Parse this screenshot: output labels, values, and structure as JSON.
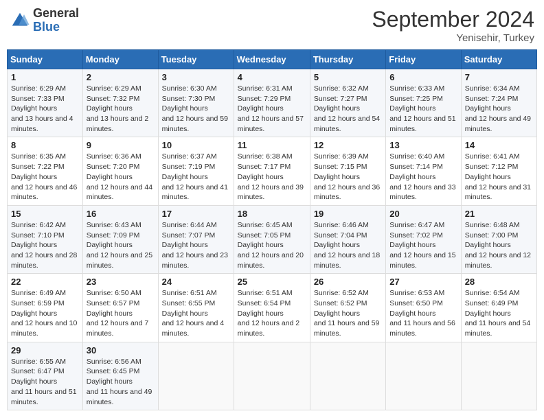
{
  "header": {
    "logo_general": "General",
    "logo_blue": "Blue",
    "month_title": "September 2024",
    "location": "Yenisehir, Turkey"
  },
  "columns": [
    "Sunday",
    "Monday",
    "Tuesday",
    "Wednesday",
    "Thursday",
    "Friday",
    "Saturday"
  ],
  "weeks": [
    [
      {
        "day": "1",
        "sunrise": "6:29 AM",
        "sunset": "7:33 PM",
        "daylight": "13 hours and 4 minutes."
      },
      {
        "day": "2",
        "sunrise": "6:29 AM",
        "sunset": "7:32 PM",
        "daylight": "13 hours and 2 minutes."
      },
      {
        "day": "3",
        "sunrise": "6:30 AM",
        "sunset": "7:30 PM",
        "daylight": "12 hours and 59 minutes."
      },
      {
        "day": "4",
        "sunrise": "6:31 AM",
        "sunset": "7:29 PM",
        "daylight": "12 hours and 57 minutes."
      },
      {
        "day": "5",
        "sunrise": "6:32 AM",
        "sunset": "7:27 PM",
        "daylight": "12 hours and 54 minutes."
      },
      {
        "day": "6",
        "sunrise": "6:33 AM",
        "sunset": "7:25 PM",
        "daylight": "12 hours and 51 minutes."
      },
      {
        "day": "7",
        "sunrise": "6:34 AM",
        "sunset": "7:24 PM",
        "daylight": "12 hours and 49 minutes."
      }
    ],
    [
      {
        "day": "8",
        "sunrise": "6:35 AM",
        "sunset": "7:22 PM",
        "daylight": "12 hours and 46 minutes."
      },
      {
        "day": "9",
        "sunrise": "6:36 AM",
        "sunset": "7:20 PM",
        "daylight": "12 hours and 44 minutes."
      },
      {
        "day": "10",
        "sunrise": "6:37 AM",
        "sunset": "7:19 PM",
        "daylight": "12 hours and 41 minutes."
      },
      {
        "day": "11",
        "sunrise": "6:38 AM",
        "sunset": "7:17 PM",
        "daylight": "12 hours and 39 minutes."
      },
      {
        "day": "12",
        "sunrise": "6:39 AM",
        "sunset": "7:15 PM",
        "daylight": "12 hours and 36 minutes."
      },
      {
        "day": "13",
        "sunrise": "6:40 AM",
        "sunset": "7:14 PM",
        "daylight": "12 hours and 33 minutes."
      },
      {
        "day": "14",
        "sunrise": "6:41 AM",
        "sunset": "7:12 PM",
        "daylight": "12 hours and 31 minutes."
      }
    ],
    [
      {
        "day": "15",
        "sunrise": "6:42 AM",
        "sunset": "7:10 PM",
        "daylight": "12 hours and 28 minutes."
      },
      {
        "day": "16",
        "sunrise": "6:43 AM",
        "sunset": "7:09 PM",
        "daylight": "12 hours and 25 minutes."
      },
      {
        "day": "17",
        "sunrise": "6:44 AM",
        "sunset": "7:07 PM",
        "daylight": "12 hours and 23 minutes."
      },
      {
        "day": "18",
        "sunrise": "6:45 AM",
        "sunset": "7:05 PM",
        "daylight": "12 hours and 20 minutes."
      },
      {
        "day": "19",
        "sunrise": "6:46 AM",
        "sunset": "7:04 PM",
        "daylight": "12 hours and 18 minutes."
      },
      {
        "day": "20",
        "sunrise": "6:47 AM",
        "sunset": "7:02 PM",
        "daylight": "12 hours and 15 minutes."
      },
      {
        "day": "21",
        "sunrise": "6:48 AM",
        "sunset": "7:00 PM",
        "daylight": "12 hours and 12 minutes."
      }
    ],
    [
      {
        "day": "22",
        "sunrise": "6:49 AM",
        "sunset": "6:59 PM",
        "daylight": "12 hours and 10 minutes."
      },
      {
        "day": "23",
        "sunrise": "6:50 AM",
        "sunset": "6:57 PM",
        "daylight": "12 hours and 7 minutes."
      },
      {
        "day": "24",
        "sunrise": "6:51 AM",
        "sunset": "6:55 PM",
        "daylight": "12 hours and 4 minutes."
      },
      {
        "day": "25",
        "sunrise": "6:51 AM",
        "sunset": "6:54 PM",
        "daylight": "12 hours and 2 minutes."
      },
      {
        "day": "26",
        "sunrise": "6:52 AM",
        "sunset": "6:52 PM",
        "daylight": "11 hours and 59 minutes."
      },
      {
        "day": "27",
        "sunrise": "6:53 AM",
        "sunset": "6:50 PM",
        "daylight": "11 hours and 56 minutes."
      },
      {
        "day": "28",
        "sunrise": "6:54 AM",
        "sunset": "6:49 PM",
        "daylight": "11 hours and 54 minutes."
      }
    ],
    [
      {
        "day": "29",
        "sunrise": "6:55 AM",
        "sunset": "6:47 PM",
        "daylight": "11 hours and 51 minutes."
      },
      {
        "day": "30",
        "sunrise": "6:56 AM",
        "sunset": "6:45 PM",
        "daylight": "11 hours and 49 minutes."
      },
      null,
      null,
      null,
      null,
      null
    ]
  ]
}
